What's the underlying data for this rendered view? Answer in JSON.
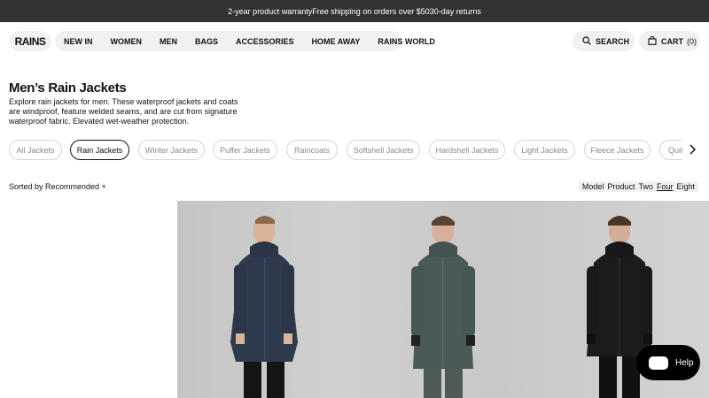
{
  "announcement": {
    "text": "2-year product warrantyFree shipping on orders over $5030-day returns"
  },
  "header": {
    "logo": "RAINS",
    "nav": [
      "NEW IN",
      "WOMEN",
      "MEN",
      "BAGS",
      "ACCESSORIES",
      "HOME AWAY",
      "RAINS WORLD"
    ],
    "search_label": "SEARCH",
    "cart_label": "CART",
    "cart_count": "(0)"
  },
  "page": {
    "title": "Men’s Rain Jackets",
    "description": "Explore rain jackets for men. These waterproof jackets and coats are windproof, feature welded seams, and are cut from signature waterproof fabric. Elevated wet-weather protection."
  },
  "filters": {
    "chips": [
      "All Jackets",
      "Rain Jackets",
      "Winter Jackets",
      "Puffer Jackets",
      "Raincoats",
      "Softshell Jackets",
      "Hardshell Jackets",
      "Light Jackets",
      "Fleece Jackets",
      "Quilt"
    ],
    "active": "Rain Jackets"
  },
  "sort": {
    "label": "Sorted by Recommended +"
  },
  "view": {
    "options": [
      "Model",
      "Product",
      "Two",
      "Four",
      "Eight"
    ],
    "selected": "Four"
  },
  "products": [
    {
      "name": "",
      "jacket_color": "#2e3a4d"
    },
    {
      "name": "",
      "jacket_color": "#4a5a58"
    },
    {
      "name": "",
      "jacket_color": "#1c1c1f"
    }
  ],
  "help": {
    "label": "Help"
  },
  "colors": {
    "announcement_bg": "#333333",
    "pill_bg": "#f1f1f1"
  },
  "icons": [
    "search-icon",
    "bag-icon",
    "chevron-right-icon",
    "chat-icon"
  ]
}
